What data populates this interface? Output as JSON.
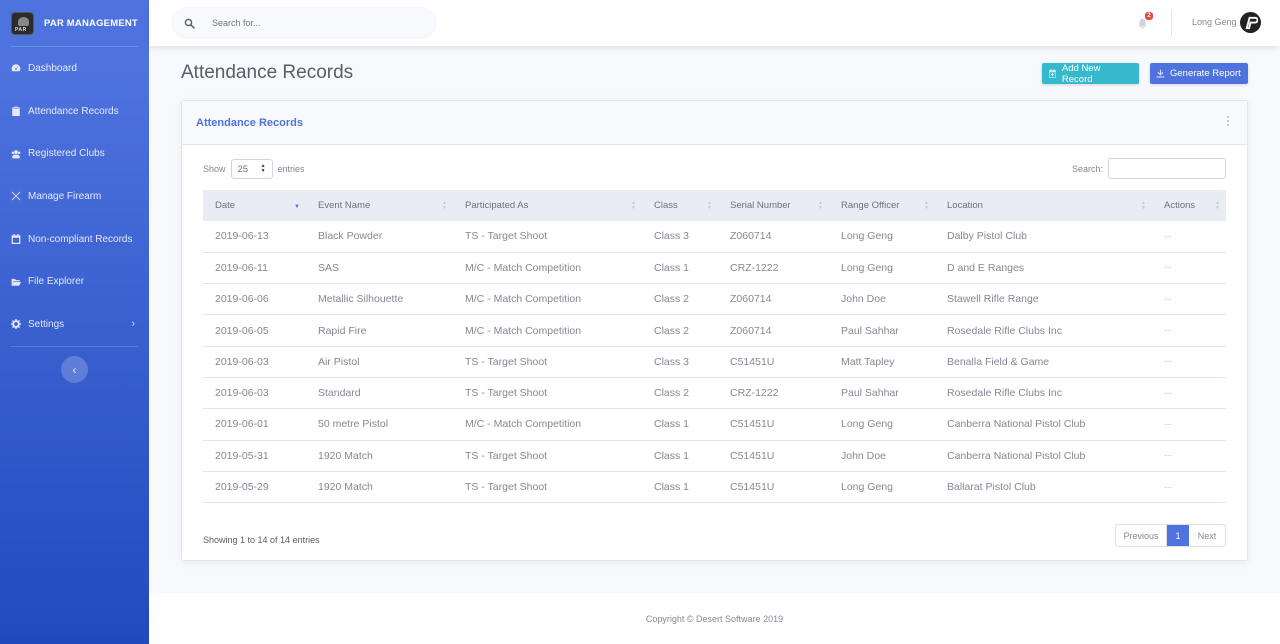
{
  "brand": {
    "name": "PAR MANAGEMENT",
    "logo_text": "PAR"
  },
  "sidebar": {
    "items": [
      {
        "label": "Dashboard",
        "icon": "tachometer-icon"
      },
      {
        "label": "Attendance Records",
        "icon": "clipboard-icon"
      },
      {
        "label": "Registered Clubs",
        "icon": "users-icon"
      },
      {
        "label": "Manage Firearm",
        "icon": "crosshair-icon"
      },
      {
        "label": "Non-compliant Records",
        "icon": "calendar-x-icon"
      },
      {
        "label": "File Explorer",
        "icon": "folder-open-icon"
      },
      {
        "label": "Settings",
        "icon": "gear-icon"
      }
    ]
  },
  "topbar": {
    "search_placeholder": "Search for...",
    "alerts_count": "2",
    "user_name": "Long Geng"
  },
  "page": {
    "title": "Attendance Records",
    "add_button": "Add New Record",
    "report_button": "Generate Report"
  },
  "card": {
    "title": "Attendance Records",
    "show_label": "Show",
    "entries_label": "entries",
    "page_length": "25",
    "search_label": "Search:",
    "info": "Showing 1 to 14 of 14 entries",
    "pagination": {
      "previous": "Previous",
      "current": "1",
      "next": "Next"
    }
  },
  "table": {
    "columns": [
      "Date",
      "Event Name",
      "Participated As",
      "Class",
      "Serial Number",
      "Range Officer",
      "Location",
      "Actions"
    ],
    "rows": [
      [
        "2019-06-13",
        "Black Powder",
        "TS - Target Shoot",
        "Class 3",
        "Z060714",
        "Long Geng",
        "Dalby Pistol Club",
        "···"
      ],
      [
        "2019-06-11",
        "SAS",
        "M/C - Match Competition",
        "Class 1",
        "CRZ-1222",
        "Long Geng",
        "D and E Ranges",
        "···"
      ],
      [
        "2019-06-06",
        "Metallic Silhouette",
        "M/C - Match Competition",
        "Class 2",
        "Z060714",
        "John Doe",
        "Stawell Rifle Range",
        "···"
      ],
      [
        "2019-06-05",
        "Rapid Fire",
        "M/C - Match Competition",
        "Class 2",
        "Z060714",
        "Paul Sahhar",
        "Rosedale Rifle Clubs Inc",
        "···"
      ],
      [
        "2019-06-03",
        "Air Pistol",
        "TS - Target Shoot",
        "Class 3",
        "C51451U",
        "Matt Tapley",
        "Benalla Field & Game",
        "···"
      ],
      [
        "2019-06-03",
        "Standard",
        "TS - Target Shoot",
        "Class 2",
        "CRZ-1222",
        "Paul Sahhar",
        "Rosedale Rifle Clubs Inc",
        "···"
      ],
      [
        "2019-06-01",
        "50 metre Pistol",
        "M/C - Match Competition",
        "Class 1",
        "C51451U",
        "Long Geng",
        "Canberra National Pistol Club",
        "···"
      ],
      [
        "2019-05-31",
        "1920 Match",
        "TS - Target Shoot",
        "Class 1",
        "C51451U",
        "John Doe",
        "Canberra National Pistol Club",
        "···"
      ],
      [
        "2019-05-29",
        "1920 Match",
        "TS - Target Shoot",
        "Class 1",
        "C51451U",
        "Long Geng",
        "Ballarat Pistol Club",
        "···"
      ]
    ]
  },
  "footer": {
    "copyright": "Copyright © Desert Software 2019"
  },
  "colors": {
    "primary": "#4e73df",
    "info": "#36b9cc",
    "danger": "#e74a3b"
  }
}
